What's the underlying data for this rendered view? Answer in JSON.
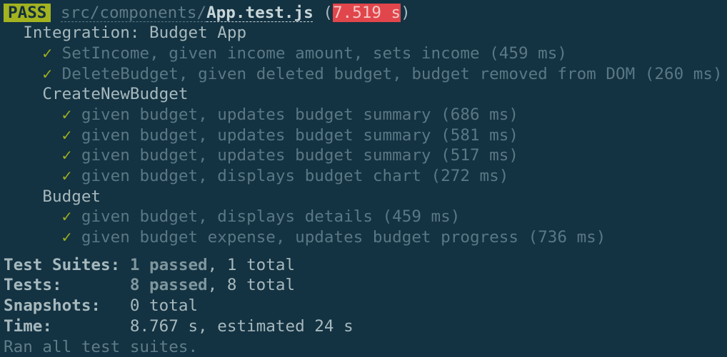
{
  "header": {
    "status": "PASS",
    "dir": "src/components/",
    "file": "App.test.js",
    "open": " (",
    "duration": "7.519 s",
    "close": ")"
  },
  "suite": "Integration: Budget App",
  "check_glyph": "✓",
  "top_tests": [
    "SetIncome, given income amount, sets income (459 ms)",
    "DeleteBudget, given deleted budget, budget removed from DOM (260 ms)"
  ],
  "groups": [
    {
      "name": "CreateNewBudget",
      "tests": [
        "given budget, updates budget summary (686 ms)",
        "given budget, updates budget summary (581 ms)",
        "given budget, updates budget summary (517 ms)",
        "given budget, displays budget chart (272 ms)"
      ]
    },
    {
      "name": "Budget",
      "tests": [
        "given budget, displays details (459 ms)",
        "given budget expense, updates budget progress (736 ms)"
      ]
    }
  ],
  "summary": {
    "suites_label": "Test Suites: ",
    "suites_passed": "1 passed",
    "suites_total": ", 1 total",
    "tests_label": "Tests:       ",
    "tests_passed": "8 passed",
    "tests_total": ", 8 total",
    "snapshots_label": "Snapshots:   ",
    "snapshots_value": "0 total",
    "time_label": "Time:        ",
    "time_value": "8.767 s, estimated 24 s",
    "ran": "Ran all test suites."
  }
}
